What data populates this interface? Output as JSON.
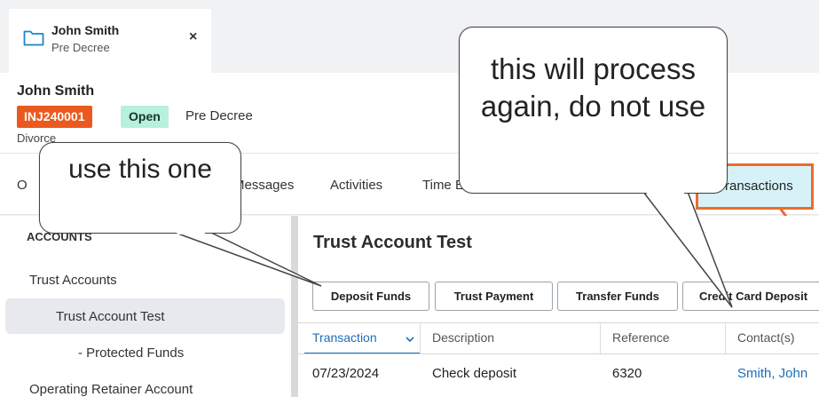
{
  "tab": {
    "name": "John Smith",
    "subtitle": "Pre Decree",
    "close_glyph": "×",
    "icon": "folder-icon"
  },
  "matter": {
    "client_name": "John Smith",
    "matter_id": "INJ240001",
    "status": "Open",
    "stage": "Pre Decree",
    "case_type": "Divorce"
  },
  "nav": {
    "items": [
      "Messages",
      "Activities",
      "Time E"
    ],
    "partial_first": "O",
    "active": "ransactions"
  },
  "sidebar": {
    "header": "ACCOUNTS",
    "items": [
      "Trust Accounts",
      "Trust Account Test",
      "- Protected Funds",
      "Operating Retainer Account"
    ]
  },
  "main": {
    "title": "Trust Account Test",
    "buttons": [
      "Deposit Funds",
      "Trust Payment",
      "Transfer Funds",
      "Credit Card Deposit"
    ],
    "columns": [
      "Transaction",
      "Description",
      "Reference",
      "Contact(s)"
    ],
    "rows": [
      {
        "transaction": "07/23/2024",
        "description": "Check deposit",
        "reference": "6320",
        "contact": "Smith, John"
      }
    ]
  },
  "annotations": {
    "left": "use this one",
    "right": "this will process again, do not use"
  },
  "colors": {
    "accent": "#ea5a1f",
    "link": "#1d6fb8",
    "open_badge": "#b7f0dd",
    "active_tab": "#d6f2f8"
  }
}
